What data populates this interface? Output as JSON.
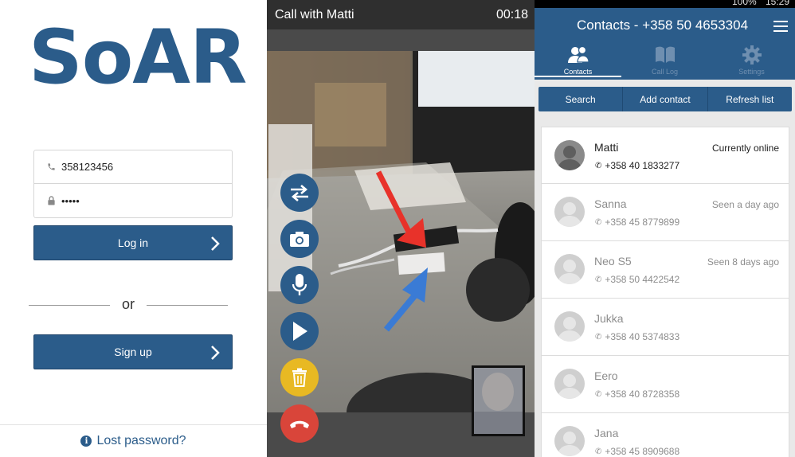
{
  "login": {
    "logo": "SoAR",
    "phone_value": "358123456",
    "password_value": "•••••",
    "login_label": "Log in",
    "or_label": "or",
    "signup_label": "Sign up",
    "lost_password_label": "Lost password?"
  },
  "call": {
    "title": "Call with Matti",
    "timer": "00:18"
  },
  "contacts": {
    "status_battery": "100%",
    "status_time": "15:29",
    "title": "Contacts - +358 50 4653304",
    "tabs": [
      {
        "label": "Contacts",
        "icon": "contacts-icon",
        "active": true
      },
      {
        "label": "Call Log",
        "icon": "book-icon",
        "active": false
      },
      {
        "label": "Settings",
        "icon": "gear-icon",
        "active": false
      }
    ],
    "actions": [
      {
        "label": "Search"
      },
      {
        "label": "Add contact"
      },
      {
        "label": "Refresh list"
      }
    ],
    "list": [
      {
        "name": "Matti",
        "phone": "+358 40 1833277",
        "status": "Currently online",
        "online": true
      },
      {
        "name": "Sanna",
        "phone": "+358 45 8779899",
        "status": "Seen a day ago",
        "online": false
      },
      {
        "name": "Neo S5",
        "phone": "+358 50 4422542",
        "status": "Seen 8 days ago",
        "online": false
      },
      {
        "name": "Jukka",
        "phone": "+358 40 5374833",
        "status": "",
        "online": false
      },
      {
        "name": "Eero",
        "phone": "+358 40 8728358",
        "status": "",
        "online": false
      },
      {
        "name": "Jana",
        "phone": "+358 45 8909688",
        "status": "",
        "online": false
      }
    ]
  },
  "colors": {
    "brand_blue": "#2b5c8a",
    "delete_yellow": "#e8b923",
    "hangup_red": "#d9453a",
    "arrow_red": "#e8322a",
    "arrow_blue": "#3a7bd5"
  }
}
